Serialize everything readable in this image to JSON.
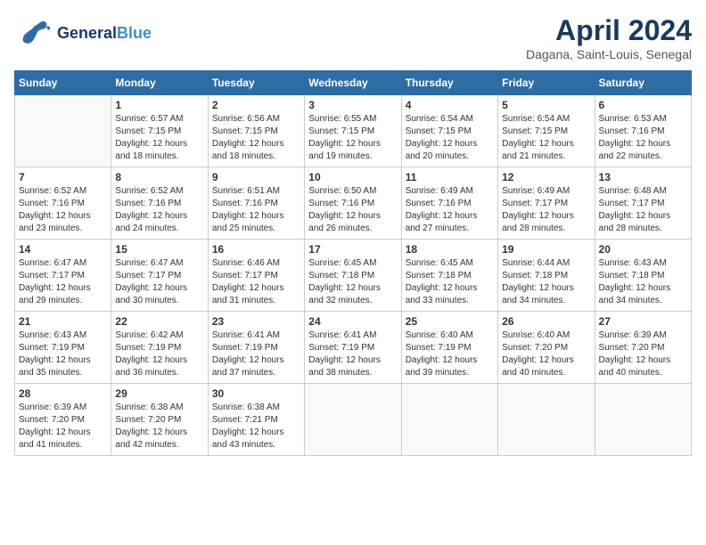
{
  "header": {
    "logo_general": "General",
    "logo_blue": "Blue",
    "month_year": "April 2024",
    "location": "Dagana, Saint-Louis, Senegal"
  },
  "days_of_week": [
    "Sunday",
    "Monday",
    "Tuesday",
    "Wednesday",
    "Thursday",
    "Friday",
    "Saturday"
  ],
  "weeks": [
    [
      {
        "day": "",
        "info": ""
      },
      {
        "day": "1",
        "info": "Sunrise: 6:57 AM\nSunset: 7:15 PM\nDaylight: 12 hours\nand 18 minutes."
      },
      {
        "day": "2",
        "info": "Sunrise: 6:56 AM\nSunset: 7:15 PM\nDaylight: 12 hours\nand 18 minutes."
      },
      {
        "day": "3",
        "info": "Sunrise: 6:55 AM\nSunset: 7:15 PM\nDaylight: 12 hours\nand 19 minutes."
      },
      {
        "day": "4",
        "info": "Sunrise: 6:54 AM\nSunset: 7:15 PM\nDaylight: 12 hours\nand 20 minutes."
      },
      {
        "day": "5",
        "info": "Sunrise: 6:54 AM\nSunset: 7:15 PM\nDaylight: 12 hours\nand 21 minutes."
      },
      {
        "day": "6",
        "info": "Sunrise: 6:53 AM\nSunset: 7:16 PM\nDaylight: 12 hours\nand 22 minutes."
      }
    ],
    [
      {
        "day": "7",
        "info": "Sunrise: 6:52 AM\nSunset: 7:16 PM\nDaylight: 12 hours\nand 23 minutes."
      },
      {
        "day": "8",
        "info": "Sunrise: 6:52 AM\nSunset: 7:16 PM\nDaylight: 12 hours\nand 24 minutes."
      },
      {
        "day": "9",
        "info": "Sunrise: 6:51 AM\nSunset: 7:16 PM\nDaylight: 12 hours\nand 25 minutes."
      },
      {
        "day": "10",
        "info": "Sunrise: 6:50 AM\nSunset: 7:16 PM\nDaylight: 12 hours\nand 26 minutes."
      },
      {
        "day": "11",
        "info": "Sunrise: 6:49 AM\nSunset: 7:16 PM\nDaylight: 12 hours\nand 27 minutes."
      },
      {
        "day": "12",
        "info": "Sunrise: 6:49 AM\nSunset: 7:17 PM\nDaylight: 12 hours\nand 28 minutes."
      },
      {
        "day": "13",
        "info": "Sunrise: 6:48 AM\nSunset: 7:17 PM\nDaylight: 12 hours\nand 28 minutes."
      }
    ],
    [
      {
        "day": "14",
        "info": "Sunrise: 6:47 AM\nSunset: 7:17 PM\nDaylight: 12 hours\nand 29 minutes."
      },
      {
        "day": "15",
        "info": "Sunrise: 6:47 AM\nSunset: 7:17 PM\nDaylight: 12 hours\nand 30 minutes."
      },
      {
        "day": "16",
        "info": "Sunrise: 6:46 AM\nSunset: 7:17 PM\nDaylight: 12 hours\nand 31 minutes."
      },
      {
        "day": "17",
        "info": "Sunrise: 6:45 AM\nSunset: 7:18 PM\nDaylight: 12 hours\nand 32 minutes."
      },
      {
        "day": "18",
        "info": "Sunrise: 6:45 AM\nSunset: 7:18 PM\nDaylight: 12 hours\nand 33 minutes."
      },
      {
        "day": "19",
        "info": "Sunrise: 6:44 AM\nSunset: 7:18 PM\nDaylight: 12 hours\nand 34 minutes."
      },
      {
        "day": "20",
        "info": "Sunrise: 6:43 AM\nSunset: 7:18 PM\nDaylight: 12 hours\nand 34 minutes."
      }
    ],
    [
      {
        "day": "21",
        "info": "Sunrise: 6:43 AM\nSunset: 7:19 PM\nDaylight: 12 hours\nand 35 minutes."
      },
      {
        "day": "22",
        "info": "Sunrise: 6:42 AM\nSunset: 7:19 PM\nDaylight: 12 hours\nand 36 minutes."
      },
      {
        "day": "23",
        "info": "Sunrise: 6:41 AM\nSunset: 7:19 PM\nDaylight: 12 hours\nand 37 minutes."
      },
      {
        "day": "24",
        "info": "Sunrise: 6:41 AM\nSunset: 7:19 PM\nDaylight: 12 hours\nand 38 minutes."
      },
      {
        "day": "25",
        "info": "Sunrise: 6:40 AM\nSunset: 7:19 PM\nDaylight: 12 hours\nand 39 minutes."
      },
      {
        "day": "26",
        "info": "Sunrise: 6:40 AM\nSunset: 7:20 PM\nDaylight: 12 hours\nand 40 minutes."
      },
      {
        "day": "27",
        "info": "Sunrise: 6:39 AM\nSunset: 7:20 PM\nDaylight: 12 hours\nand 40 minutes."
      }
    ],
    [
      {
        "day": "28",
        "info": "Sunrise: 6:39 AM\nSunset: 7:20 PM\nDaylight: 12 hours\nand 41 minutes."
      },
      {
        "day": "29",
        "info": "Sunrise: 6:38 AM\nSunset: 7:20 PM\nDaylight: 12 hours\nand 42 minutes."
      },
      {
        "day": "30",
        "info": "Sunrise: 6:38 AM\nSunset: 7:21 PM\nDaylight: 12 hours\nand 43 minutes."
      },
      {
        "day": "",
        "info": ""
      },
      {
        "day": "",
        "info": ""
      },
      {
        "day": "",
        "info": ""
      },
      {
        "day": "",
        "info": ""
      }
    ]
  ]
}
